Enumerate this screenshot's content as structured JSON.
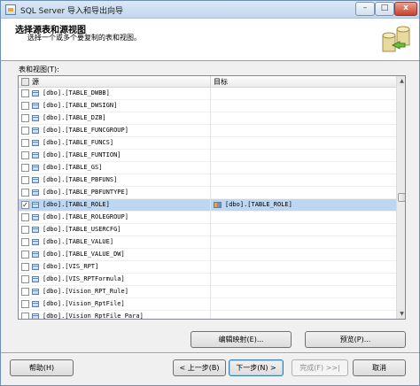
{
  "window": {
    "title": "SQL Server 导入和导出向导",
    "controls": {
      "minimize": "–",
      "maximize": "□",
      "close": "x"
    }
  },
  "header": {
    "title": "选择源表和源视图",
    "subtitle": "选择一个或多个要复制的表和视图。"
  },
  "section_label": "表和视图(T):",
  "grid": {
    "columns": {
      "source": "源",
      "target": "目标"
    },
    "rows": [
      {
        "checked": false,
        "source": "[dbo].[TABLE_DWBB]",
        "target": ""
      },
      {
        "checked": false,
        "source": "[dbo].[TABLE_DWSIGN]",
        "target": ""
      },
      {
        "checked": false,
        "source": "[dbo].[TABLE_DZB]",
        "target": ""
      },
      {
        "checked": false,
        "source": "[dbo].[TABLE_FUNCGROUP]",
        "target": ""
      },
      {
        "checked": false,
        "source": "[dbo].[TABLE_FUNCS]",
        "target": ""
      },
      {
        "checked": false,
        "source": "[dbo].[TABLE_FUNTION]",
        "target": ""
      },
      {
        "checked": false,
        "source": "[dbo].[TABLE_GS]",
        "target": ""
      },
      {
        "checked": false,
        "source": "[dbo].[TABLE_PBFUNS]",
        "target": ""
      },
      {
        "checked": false,
        "source": "[dbo].[TABLE_PBFUNTYPE]",
        "target": ""
      },
      {
        "checked": true,
        "source": "[dbo].[TABLE_ROLE]",
        "target": "[dbo].[TABLE_ROLE]"
      },
      {
        "checked": false,
        "source": "[dbo].[TABLE_ROLEGROUP]",
        "target": ""
      },
      {
        "checked": false,
        "source": "[dbo].[TABLE_USERCFG]",
        "target": ""
      },
      {
        "checked": false,
        "source": "[dbo].[TABLE_VALUE]",
        "target": ""
      },
      {
        "checked": false,
        "source": "[dbo].[TABLE_VALUE_DW]",
        "target": ""
      },
      {
        "checked": false,
        "source": "[dbo].[VIS_RPT]",
        "target": ""
      },
      {
        "checked": false,
        "source": "[dbo].[VIS_RPTFormula]",
        "target": ""
      },
      {
        "checked": false,
        "source": "[dbo].[Vision_RPT_Rule]",
        "target": ""
      },
      {
        "checked": false,
        "source": "[dbo].[Vision_RptFile]",
        "target": ""
      },
      {
        "checked": false,
        "source": "[dbo].[Vision_RptFile_Para]",
        "target": ""
      }
    ]
  },
  "buttons": {
    "edit_mappings": "编辑映射(E)...",
    "preview": "预览(P)...",
    "help": "帮助(H)",
    "back": "< 上一步(B)",
    "next": "下一步(N) >",
    "finish": "完成(F) >>|",
    "cancel": "取消"
  }
}
